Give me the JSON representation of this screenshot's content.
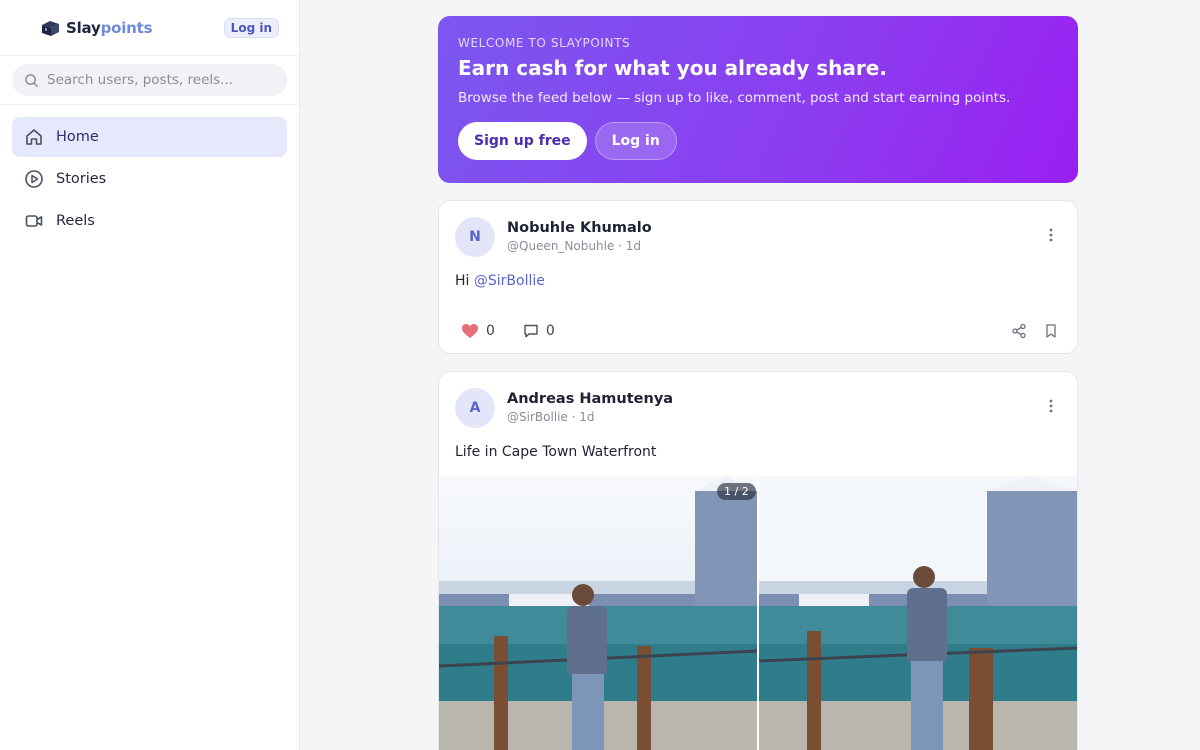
{
  "app": {
    "logo_part1": "Slay",
    "logo_part2": "points",
    "login_label": "Log in"
  },
  "search": {
    "placeholder": "Search users, posts, reels..."
  },
  "nav": [
    {
      "label": "Home",
      "icon": "home-icon",
      "active": true
    },
    {
      "label": "Stories",
      "icon": "play-circle-icon",
      "active": false
    },
    {
      "label": "Reels",
      "icon": "video-icon",
      "active": false
    }
  ],
  "hero": {
    "kicker": "WELCOME TO SLAYPOINTS",
    "title": "Earn cash for what you already share.",
    "subtitle": "Browse the feed below — sign up to like, comment, post and start earning points.",
    "signup_label": "Sign up free",
    "login_label": "Log in"
  },
  "posts": [
    {
      "initial": "N",
      "name": "Nobuhle Khumalo",
      "handle": "@Queen_Nobuhle",
      "time": "1d",
      "text": "Hi ",
      "mention": "@SirBollie",
      "likes": "0",
      "comments": "0"
    },
    {
      "initial": "A",
      "name": "Andreas Hamutenya",
      "handle": "@SirBollie",
      "time": "1d",
      "text": "Life in Cape Town Waterfront",
      "media_counter": "1 / 2"
    }
  ],
  "colors": {
    "accent": "#5a63d0",
    "hero_start": "#7b57ef",
    "hero_end": "#9a1ff2",
    "like_heart": "#e2555f"
  }
}
